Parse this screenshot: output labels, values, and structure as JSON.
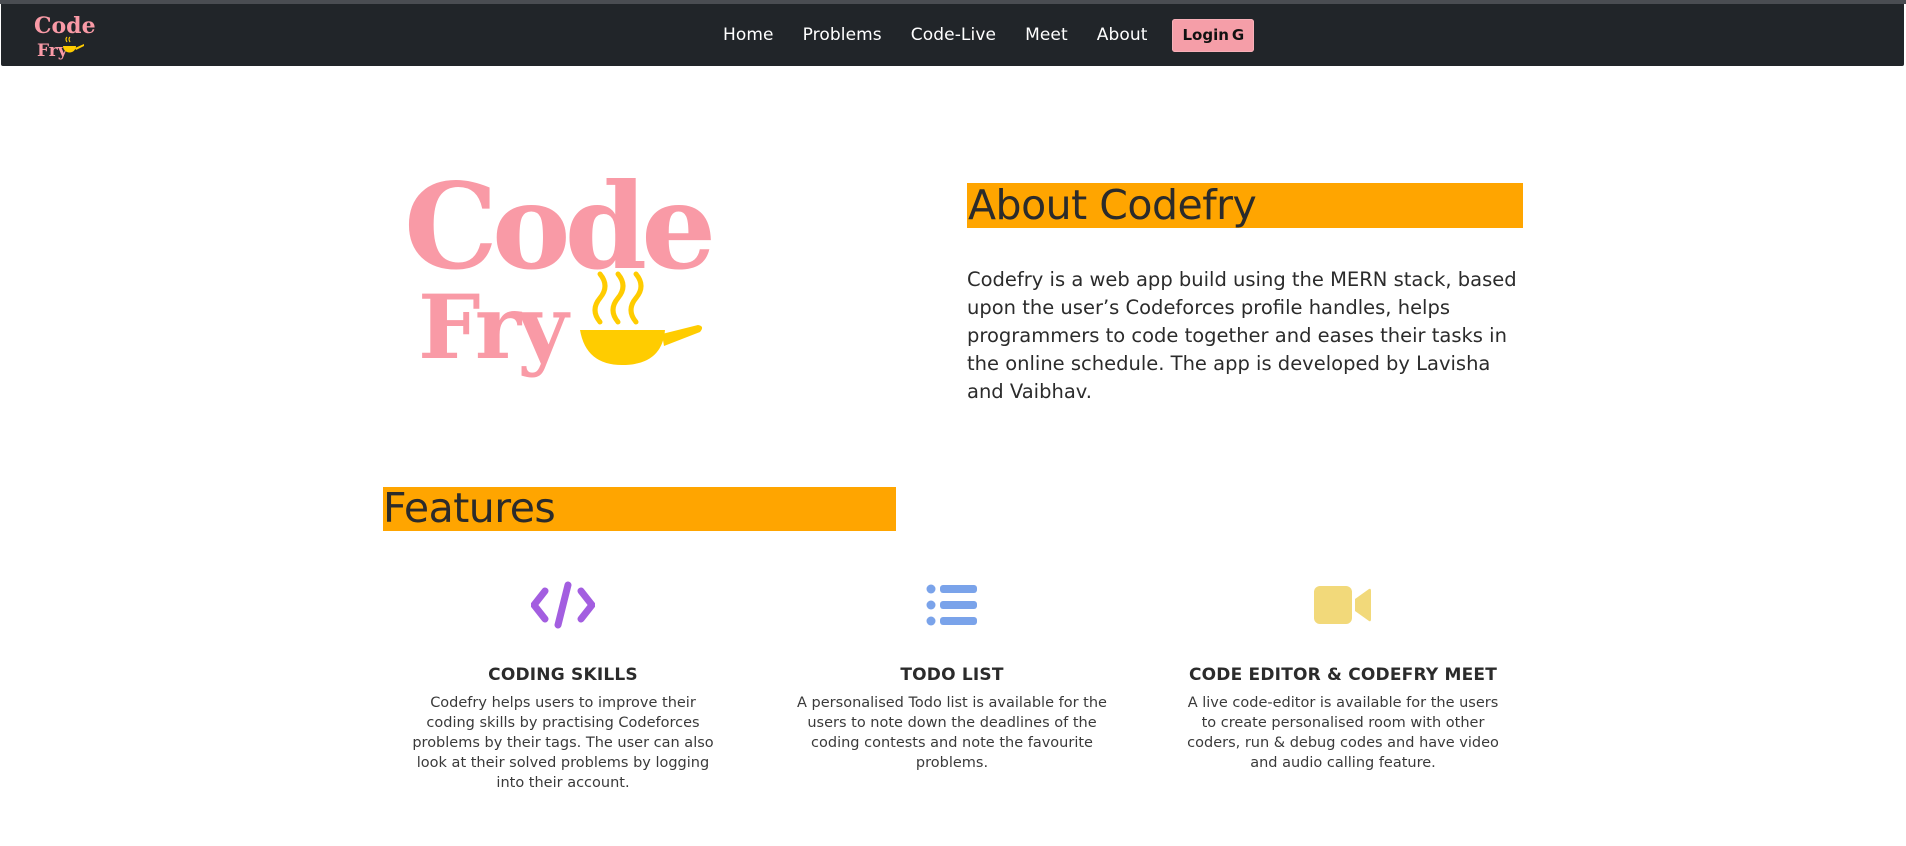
{
  "navbar": {
    "brand_logo": "codefry-logo",
    "links": [
      "Home",
      "Problems",
      "Code-Live",
      "Meet",
      "About"
    ],
    "login_label": "Login",
    "login_icon": "google-g-icon",
    "login_icon_glyph": "G"
  },
  "about": {
    "title": "About Codefry",
    "text": "Codefry is a web app build using the MERN stack, based upon the user’s Codeforces profile handles, helps programmers to code together and eases their tasks in the online schedule. The app is developed by Lavisha and Vaibhav."
  },
  "features": {
    "title": "Features",
    "items": [
      {
        "icon": "code-icon",
        "title": "CODING SKILLS",
        "description": "Codefry helps users to improve their coding skills by practising Codeforces problems by their tags. The user can also look at their solved problems by logging into their account."
      },
      {
        "icon": "list-icon",
        "title": "TODO LIST",
        "description": "A personalised Todo list is available for the users to note down the deadlines of the coding contests and note the favourite problems."
      },
      {
        "icon": "video-camera-icon",
        "title": "CODE EDITOR & CODEFRY MEET",
        "description": "A live code-editor is available for the users to create personalised room with other coders, run & debug codes and have video and audio calling feature."
      }
    ]
  },
  "colors": {
    "navbar_bg": "#212529",
    "brand_pink": "#f99aa6",
    "pan_yellow": "#ffcc00",
    "highlight_orange": "#ffa500",
    "code_icon": "#a35ee0",
    "list_icon": "#7aa3ea",
    "video_icon": "#f2d97a",
    "login_bg": "#f59ea8"
  }
}
